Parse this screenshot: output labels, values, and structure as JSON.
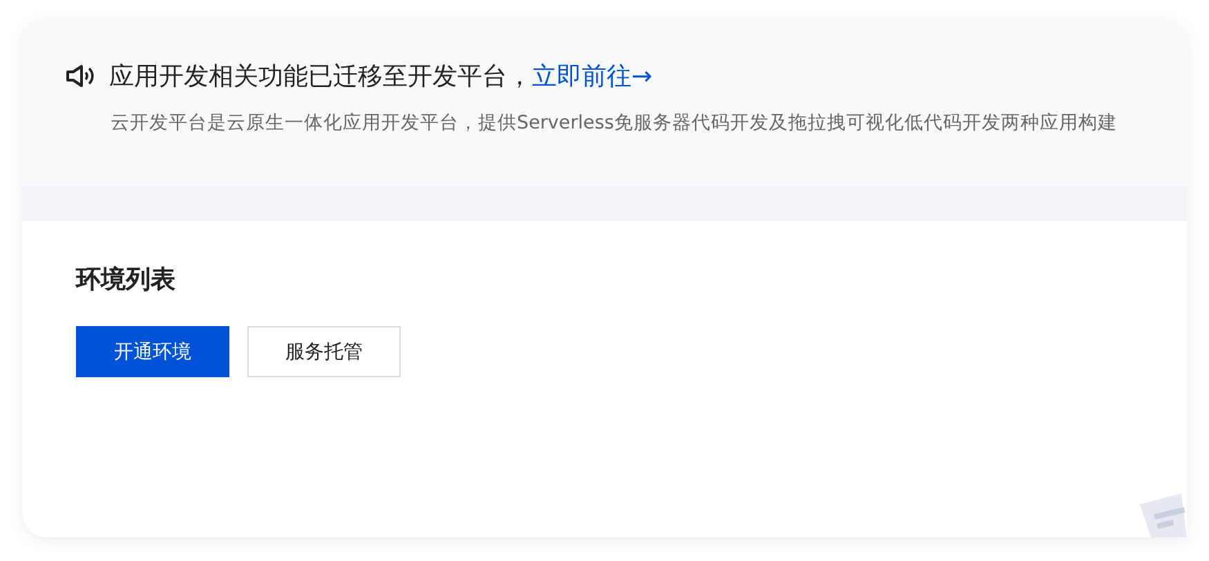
{
  "notice": {
    "title": "应用开发相关功能已迁移至开发平台，",
    "link": "立即前往→",
    "description": "云开发平台是云原生一体化应用开发平台，提供Serverless免服务器代码开发及拖拉拽可视化低代码开发两种应用构建"
  },
  "section": {
    "title": "环境列表"
  },
  "buttons": [
    {
      "label": "开通环境",
      "kind": "primary"
    },
    {
      "label": "服务托管",
      "kind": "default"
    }
  ]
}
